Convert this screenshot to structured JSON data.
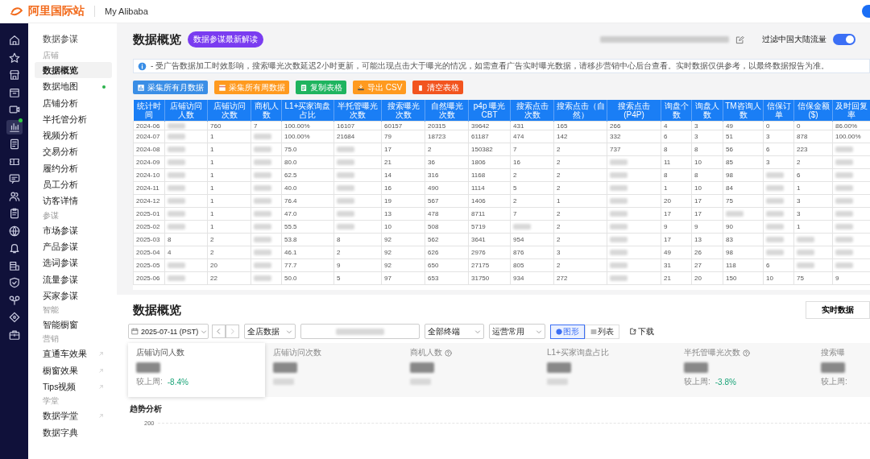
{
  "topbar": {
    "logo": "阿里国际站",
    "app": "My Alibaba"
  },
  "icon_rail": [
    {
      "selected": false,
      "dot": false
    },
    {
      "selected": false,
      "dot": false
    },
    {
      "selected": false,
      "dot": false
    },
    {
      "selected": false,
      "dot": false
    },
    {
      "selected": false,
      "dot": false
    },
    {
      "selected": true,
      "dot": true
    },
    {
      "selected": false,
      "dot": false
    },
    {
      "selected": false,
      "dot": false
    },
    {
      "selected": false,
      "dot": false
    },
    {
      "selected": false,
      "dot": false
    },
    {
      "selected": false,
      "dot": false
    },
    {
      "selected": false,
      "dot": false
    },
    {
      "selected": false,
      "dot": false
    },
    {
      "selected": false,
      "dot": false
    },
    {
      "selected": false,
      "dot": false
    },
    {
      "selected": false,
      "dot": false
    },
    {
      "selected": false,
      "dot": false
    },
    {
      "selected": false,
      "dot": false
    }
  ],
  "sidebar": {
    "title": "数据参谋",
    "groups": [
      {
        "label": "店铺",
        "items": [
          {
            "label": "数据概览",
            "selected": true,
            "dot": false,
            "external": false
          },
          {
            "label": "数据地图",
            "selected": false,
            "dot": true,
            "external": false
          },
          {
            "label": "店铺分析",
            "selected": false,
            "dot": false,
            "external": false
          },
          {
            "label": "半托管分析",
            "selected": false,
            "dot": false,
            "external": false
          },
          {
            "label": "视频分析",
            "selected": false,
            "dot": false,
            "external": false
          },
          {
            "label": "交易分析",
            "selected": false,
            "dot": false,
            "external": false
          },
          {
            "label": "履约分析",
            "selected": false,
            "dot": false,
            "external": false
          },
          {
            "label": "员工分析",
            "selected": false,
            "dot": false,
            "external": false
          },
          {
            "label": "访客详情",
            "selected": false,
            "dot": false,
            "external": false
          }
        ]
      },
      {
        "label": "参谋",
        "items": [
          {
            "label": "市场参谋",
            "selected": false,
            "dot": false,
            "external": false
          },
          {
            "label": "产品参谋",
            "selected": false,
            "dot": false,
            "external": false
          },
          {
            "label": "选词参谋",
            "selected": false,
            "dot": false,
            "external": false
          },
          {
            "label": "流量参谋",
            "selected": false,
            "dot": false,
            "external": false
          },
          {
            "label": "买家参谋",
            "selected": false,
            "dot": false,
            "external": false
          }
        ]
      },
      {
        "label": "智能",
        "items": [
          {
            "label": "智能橱窗",
            "selected": false,
            "dot": false,
            "external": false
          }
        ]
      },
      {
        "label": "营销",
        "items": [
          {
            "label": "直通车效果",
            "selected": false,
            "dot": false,
            "external": true
          },
          {
            "label": "橱窗效果",
            "selected": false,
            "dot": false,
            "external": true
          },
          {
            "label": "Tips视频",
            "selected": false,
            "dot": false,
            "external": true
          }
        ]
      },
      {
        "label": "学堂",
        "items": [
          {
            "label": "数据学堂",
            "selected": false,
            "dot": false,
            "external": true
          },
          {
            "label": "数据字典",
            "selected": false,
            "dot": false,
            "external": false
          }
        ]
      }
    ]
  },
  "header": {
    "title": "数据概览",
    "badge": "数据参谋最新解读",
    "filter_label": "过滤中国大陆流量",
    "filter_on": true
  },
  "notice": "- 受广告数据加工时效影响，搜索曝光次数延迟2小时更新，可能出现点击大于曝光的情况，如需查看广告实时曝光数据，请移步营销中心后台查看。实时数据仅供参考，以最终数据报告为准。",
  "toolbar": [
    {
      "label": "采集所有月数据",
      "color": "#3a8ee6"
    },
    {
      "label": "采集所有周数据",
      "color": "#ff9a1f"
    },
    {
      "label": "复制表格",
      "color": "#1fb45f"
    },
    {
      "label": "导出 CSV",
      "color": "#ff9a1f"
    },
    {
      "label": "清空表格",
      "color": "#f2541f"
    }
  ],
  "table": {
    "columns": [
      "统计时间",
      "店铺访问人数",
      "店铺访问次数",
      "商机人数",
      "L1+买家询盘占比",
      "半托管曝光次数",
      "搜索曝光次数",
      "自然曝光次数",
      "p4p 曝光 CBT",
      "搜索点击次数",
      "搜索点击（自然）",
      "搜索点击 (P4P)",
      "询盘个数",
      "询盘人数",
      "TM咨询人数",
      "信保订单",
      "信保金额($)",
      "及时回复率"
    ],
    "rows": [
      [
        "2024-06",
        null,
        "760",
        "7",
        "100.00%",
        "16107",
        "60157",
        "20315",
        "39642",
        "431",
        "165",
        "266",
        "4",
        "3",
        "49",
        "0",
        "0",
        "86.00%"
      ],
      [
        "2024-07",
        null,
        "1",
        null,
        "100.00%",
        "21684",
        "79",
        "18723",
        "61187",
        "474",
        "142",
        "332",
        "6",
        "3",
        "51",
        "3",
        "878",
        "100.00%"
      ],
      [
        "2024-08",
        null,
        "1",
        null,
        "75.0",
        null,
        "17",
        "2",
        "150382",
        "7",
        "2",
        "737",
        "8",
        "8",
        "56",
        "6",
        "223",
        null
      ],
      [
        "2024-09",
        null,
        "1",
        null,
        "80.0",
        null,
        "21",
        "36",
        "1806",
        "16",
        "2",
        null,
        "11",
        "10",
        "85",
        "3",
        "2",
        null
      ],
      [
        "2024-10",
        null,
        "1",
        null,
        "62.5",
        null,
        "14",
        "316",
        "1168",
        "2",
        "2",
        null,
        "8",
        "8",
        "98",
        null,
        "6",
        null
      ],
      [
        "2024-11",
        null,
        "1",
        null,
        "40.0",
        null,
        "16",
        "490",
        "1114",
        "5",
        "2",
        null,
        "1",
        "10",
        "84",
        null,
        "1",
        null
      ],
      [
        "2024-12",
        null,
        "1",
        null,
        "76.4",
        null,
        "19",
        "567",
        "1406",
        "2",
        "1",
        null,
        "20",
        "17",
        "75",
        null,
        "3",
        null
      ],
      [
        "2025-01",
        null,
        "1",
        null,
        "47.0",
        null,
        "13",
        "478",
        "8711",
        "7",
        "2",
        null,
        "17",
        "17",
        null,
        null,
        "3",
        null
      ],
      [
        "2025-02",
        null,
        "1",
        null,
        "55.5",
        null,
        "10",
        "508",
        "5719",
        null,
        "2",
        null,
        "9",
        "9",
        "90",
        null,
        "1",
        null
      ],
      [
        "2025-03",
        "8",
        "2",
        null,
        "53.8",
        "8",
        "92",
        "562",
        "3641",
        "954",
        "2",
        null,
        "17",
        "13",
        "83",
        null,
        null,
        null
      ],
      [
        "2025-04",
        "4",
        "2",
        null,
        "46.1",
        "2",
        "92",
        "626",
        "2976",
        "876",
        "3",
        null,
        "49",
        "26",
        "98",
        null,
        null,
        null
      ],
      [
        "2025-05",
        null,
        "20",
        null,
        "77.7",
        "9",
        "92",
        "650",
        "27175",
        "805",
        "2",
        null,
        "31",
        "27",
        "118",
        "6",
        null,
        null
      ],
      [
        "2025-06",
        null,
        "22",
        null,
        "50.0",
        "5",
        "97",
        "653",
        "31750",
        "934",
        "272",
        null,
        "21",
        "20",
        "150",
        "10",
        "75",
        "9"
      ]
    ]
  },
  "overview": {
    "title": "数据概览",
    "realtime_button": "实时数据",
    "date": "2025-07-11 (PST)",
    "scope": "全店数据",
    "terminal": "全部终端",
    "preset": "运营常用",
    "views": [
      {
        "label": "图形",
        "selected": true
      },
      {
        "label": "列表",
        "selected": false
      }
    ],
    "download": "下载",
    "cards": [
      {
        "title": "店铺访问人数",
        "help": false,
        "selected": true,
        "compare_label": "较上周:",
        "change": "-8.4%"
      },
      {
        "title": "店铺访问次数",
        "help": false,
        "selected": false
      },
      {
        "title": "商机人数",
        "help": true,
        "selected": false
      },
      {
        "title": "L1+买家询盘占比",
        "help": false,
        "selected": false
      },
      {
        "title": "半托管曝光次数",
        "help": true,
        "selected": false,
        "compare_label": "较上周:",
        "change": "-3.8%"
      },
      {
        "title": "搜索曝",
        "help": false,
        "selected": false,
        "compare_label": "较上周:"
      }
    ],
    "trend_title": "趋势分析",
    "y_tick": "200"
  }
}
